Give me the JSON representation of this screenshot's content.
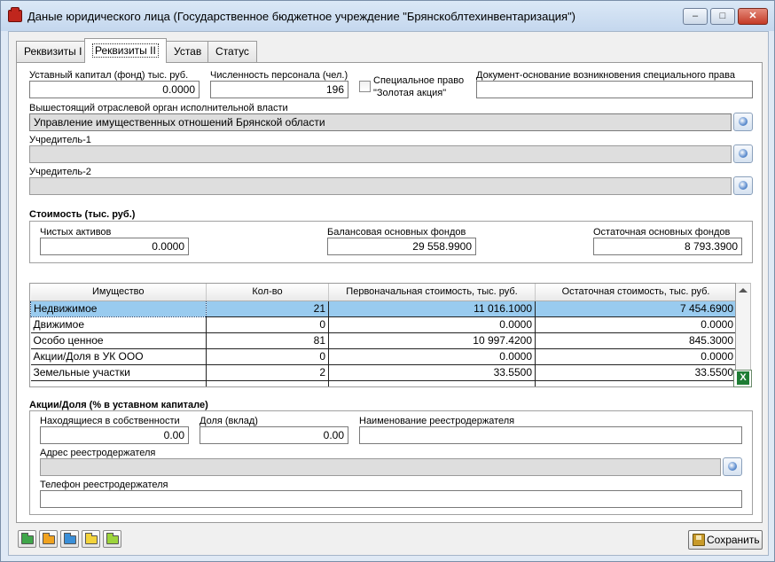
{
  "window": {
    "title": "Даные юридического лица (Государственное бюджетное учреждение \"Брянскоблтехинвентаризация\")",
    "min_glyph": "–",
    "max_glyph": "□",
    "close_glyph": "✕"
  },
  "tabs": [
    {
      "label": "Реквизиты I",
      "active": false
    },
    {
      "label": "Реквизиты II",
      "active": true
    },
    {
      "label": "Устав",
      "active": false
    },
    {
      "label": "Статус",
      "active": false
    }
  ],
  "form": {
    "capital": {
      "label": "Уставный капитал (фонд) тыс. руб.",
      "value": "0.0000"
    },
    "staff": {
      "label": "Численность персонала (чел.)",
      "value": "196"
    },
    "golden_share": {
      "label_line1": "Специальное право",
      "label_line2": "\"Золотая акция\"",
      "checked": false
    },
    "special_right_doc": {
      "label": "Документ-основание возникновения специального права",
      "value": ""
    },
    "authority": {
      "label": "Вышестоящий отраслевой орган исполнительной власти",
      "value": "Управление имущественных отношений Брянской области"
    },
    "founder1": {
      "label": "Учредитель-1",
      "value": ""
    },
    "founder2": {
      "label": "Учредитель-2",
      "value": ""
    }
  },
  "cost": {
    "title": "Стоимость (тыс. руб.)",
    "net_assets": {
      "label": "Чистых активов",
      "value": "0.0000"
    },
    "balance_fixed": {
      "label": "Балансовая основных фондов",
      "value": "29 558.9900"
    },
    "residual_fixed": {
      "label": "Остаточная основных фондов",
      "value": "8 793.3900"
    }
  },
  "property_table": {
    "columns": [
      "Имущество",
      "Кол-во",
      "Первоначальная стоимость, тыс. руб.",
      "Остаточная стоимость, тыс. руб."
    ],
    "rows": [
      {
        "name": "Недвижимое",
        "count": "21",
        "initial": "11 016.1000",
        "residual": "7 454.6900",
        "selected": true
      },
      {
        "name": "Движимое",
        "count": "0",
        "initial": "0.0000",
        "residual": "0.0000",
        "selected": false
      },
      {
        "name": "Особо ценное",
        "count": "81",
        "initial": "10 997.4200",
        "residual": "845.3000",
        "selected": false
      },
      {
        "name": "Акции/Доля в УК ООО",
        "count": "0",
        "initial": "0.0000",
        "residual": "0.0000",
        "selected": false
      },
      {
        "name": "Земельные участки",
        "count": "2",
        "initial": "33.5500",
        "residual": "33.5500",
        "selected": false
      }
    ]
  },
  "shares": {
    "title": "Акции/Доля (% в уставном капитале)",
    "owned": {
      "label": "Находящиеся в собственности",
      "value": "0.00"
    },
    "stake": {
      "label": "Доля (вклад)",
      "value": "0.00"
    },
    "registrar_name": {
      "label": "Наименование реестродержателя",
      "value": ""
    },
    "registrar_address": {
      "label": "Адрес реестродержателя",
      "value": ""
    },
    "registrar_phone": {
      "label": "Телефон реестродержателя",
      "value": ""
    }
  },
  "footer": {
    "folder_buttons": [
      {
        "color": "#3fa64a"
      },
      {
        "color": "#f0a21f"
      },
      {
        "color": "#3a8fd8"
      },
      {
        "color": "#f2d33b"
      },
      {
        "color": "#9cd43c"
      }
    ],
    "save_label": "Сохранить"
  }
}
